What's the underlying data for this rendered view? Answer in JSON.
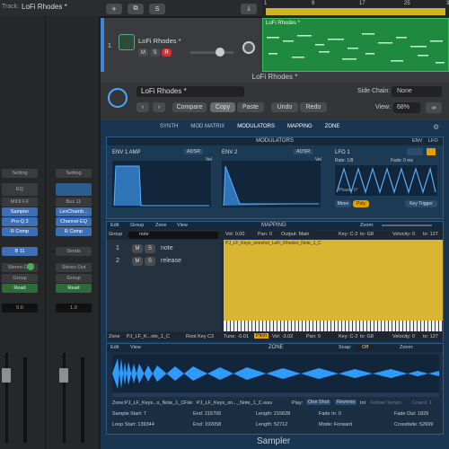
{
  "top": {
    "track_label": "Track:",
    "track_name": "LoFi Rhodes *"
  },
  "ruler": {
    "marks": [
      "1",
      "9",
      "17",
      "25",
      "33"
    ]
  },
  "track": {
    "number": "1",
    "name": "LoFi Rhodes *",
    "region": "LoFi Rhodes *",
    "m": "M",
    "s": "S",
    "r": "R"
  },
  "mixer": {
    "strip1": {
      "setting": "Setting",
      "eq": "EQ",
      "midi_fx": "MIDI FX",
      "instrument": "Sampler",
      "inserts": [
        "Pro-Q 3",
        "R Comp"
      ],
      "bus": "B 11",
      "out": "Stereo Out",
      "group": "Group",
      "read": "Read",
      "value": "0.0"
    },
    "strip2": {
      "setting": "Setting",
      "bus": "Bus 11",
      "inserts": [
        "LexChamb...",
        "Channel EQ",
        "R Comp"
      ],
      "sends": "Sends",
      "out": "Stereo Out",
      "group": "Group",
      "read": "Read",
      "value": "1.0"
    }
  },
  "plugin": {
    "window_title": "LoFi Rhodes *",
    "preset": "LoFi Rhodes *",
    "side_chain_label": "Side Chain:",
    "side_chain_value": "None",
    "view_label": "View:",
    "view_value": "68%",
    "buttons": {
      "compare": "Compare",
      "copy": "Copy",
      "paste": "Paste",
      "undo": "Undo",
      "redo": "Redo"
    },
    "tabs": [
      "SYNTH",
      "MOD MATRIX",
      "MODULATORS",
      "MAPPING",
      "ZONE"
    ],
    "modulators": {
      "title": "MODULATORS",
      "env_tab": "ENV",
      "lfo_tab": "LFO",
      "env1": {
        "title": "ENV 1 AMP",
        "mode": "ADSR",
        "vel": "Vel"
      },
      "env2": {
        "title": "ENV 2",
        "mode": "ADSR",
        "vel": "Vel"
      },
      "lfo1": {
        "title": "LFO 1",
        "rate": "Rate: 1/8",
        "fade": "Fade: 0 ms",
        "phase": "Phase: 0°",
        "mono": "Mono",
        "poly": "Poly",
        "key_trigger": "Key Trigger"
      }
    },
    "mapping": {
      "title": "MAPPING",
      "menus": [
        "Edit",
        "Group",
        "Zone",
        "View"
      ],
      "zoom": "Zoom:",
      "header": {
        "group": "Group",
        "vol": "Vol: 0.00",
        "pan": "Pan: 0",
        "output": "Output: Main",
        "key": "Key: C-2",
        "to1": "to: G8",
        "velocity": "Velocity: 0",
        "to2": "to: 127"
      },
      "search": "note",
      "groups": [
        {
          "num": "1",
          "m": "M",
          "s": "S",
          "name": "note"
        },
        {
          "num": "2",
          "m": "M",
          "s": "S",
          "name": "release"
        }
      ],
      "zone_name": "PJ_LF_Keys_oneshot_LoFi_Rhodes_Note_1_C",
      "zone_bar": {
        "zone": "Zone",
        "name": "PJ_LF_K...ote_1_C",
        "root_key_label": "Root Key",
        "root_key": "C3",
        "tune": "Tune: -0.01",
        "pitch": "Pitch",
        "vol": "Vol: -3.02",
        "pan": "Pan: 0",
        "key": "Key: C-2",
        "to1": "to: G8",
        "velocity": "Velocity: 0",
        "to2": "to: 127"
      }
    },
    "zone": {
      "title": "ZONE",
      "menus": [
        "Edit",
        "View"
      ],
      "snap": "Snap:",
      "snap_value": "Off",
      "zoom": "Zoom:",
      "zone_label": "Zone:",
      "zone_name": "PJ_LF_Keys...s_Note_1_C",
      "file_label": "File:",
      "file_name": "PJ_LF_Keys_on..._Note_1_C.wav",
      "play_label": "Play:",
      "one_shot": "One Shot",
      "reverse": "Reverse",
      "int": "Int",
      "follow_tempo": "Follow Tempo",
      "coarse": "Coarsl: 1",
      "sample_start": "Sample Start: 7",
      "end1": "End: 215705",
      "length1": "Length: 215628",
      "fade_in": "Fade In: 0",
      "fade_out": "Fade Out: 1829",
      "loop_start": "Loop Start: 139344",
      "end2": "End: 192058",
      "length2": "Length: 52712",
      "mode": "Mode: Forward",
      "crossfade": "Crossfade: 52699"
    },
    "footer": "Sampler"
  }
}
